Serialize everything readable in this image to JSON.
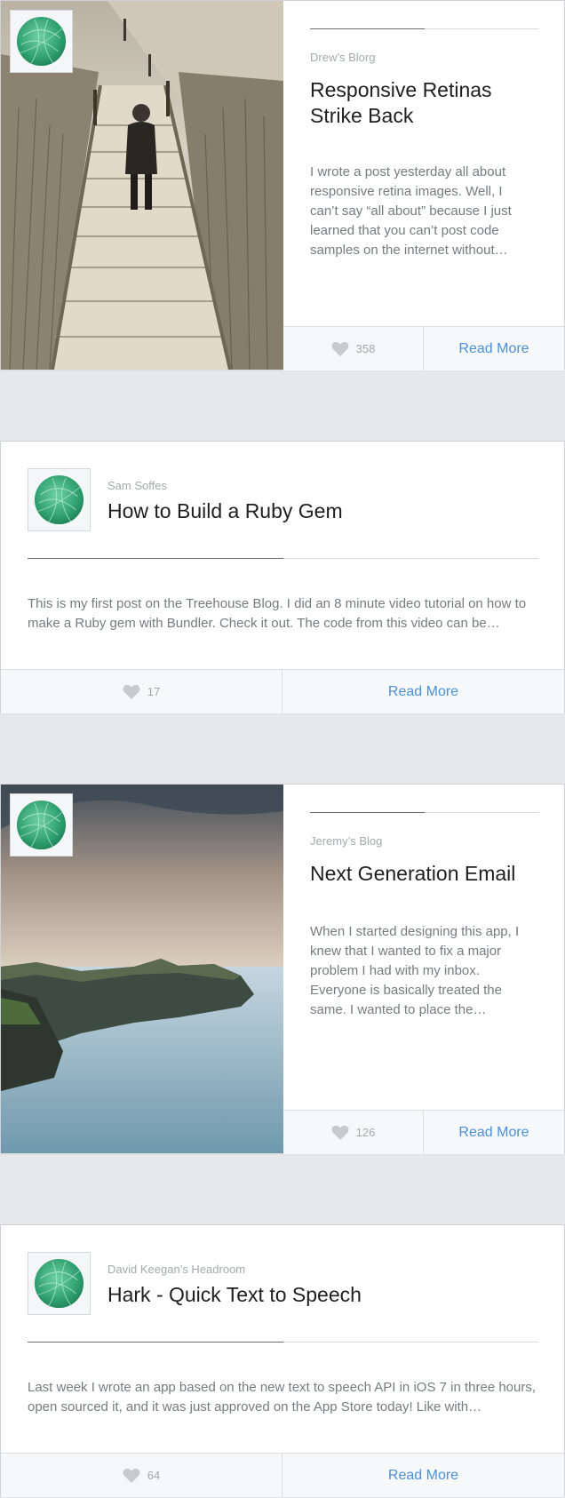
{
  "posts": [
    {
      "blog": "Drew’s Blorg",
      "title_lines": [
        "Responsive Retinas",
        "Strike Back"
      ],
      "excerpt_lines": [
        "I wrote a post yesterday all about",
        "responsive retina images. Well, I",
        "can’t say “all about” because I just",
        "learned that you can’t post code",
        "samples on the internet without…"
      ],
      "likes": "358",
      "read_more": "Read More"
    },
    {
      "blog": "Sam Soffes",
      "title_lines": [
        "How to Build a Ruby Gem"
      ],
      "excerpt_lines": [
        "This is my first post on the Treehouse Blog. I did an 8 minute video tutorial on how to",
        "make a Ruby gem with Bundler. Check it out. The code from this video can be…"
      ],
      "likes": "17",
      "read_more": "Read More"
    },
    {
      "blog": "Jeremy’s Blog",
      "title_lines": [
        "Next Generation Email"
      ],
      "excerpt_lines": [
        "When I started designing this app, I",
        "knew that I wanted to fix a major",
        "problem I had with my inbox.",
        "Everyone is basically treated the",
        "same. I wanted to place the…"
      ],
      "likes": "126",
      "read_more": "Read More"
    },
    {
      "blog": "David Keegan’s Headroom",
      "title_lines": [
        "Hark - Quick Text to Speech"
      ],
      "excerpt_lines": [
        "Last week I wrote an app based on the new text to speech API in iOS 7 in three hours,",
        "open sourced it, and it was just approved on the App Store today! Like with…"
      ],
      "likes": "64",
      "read_more": "Read More"
    }
  ],
  "icons": {
    "avatar": "avatar-leaf-icon",
    "like": "heart-icon"
  },
  "colors": {
    "accent": "#4a90d9",
    "background": "#e6e8ec",
    "avatar_green": "#3aa57a"
  }
}
